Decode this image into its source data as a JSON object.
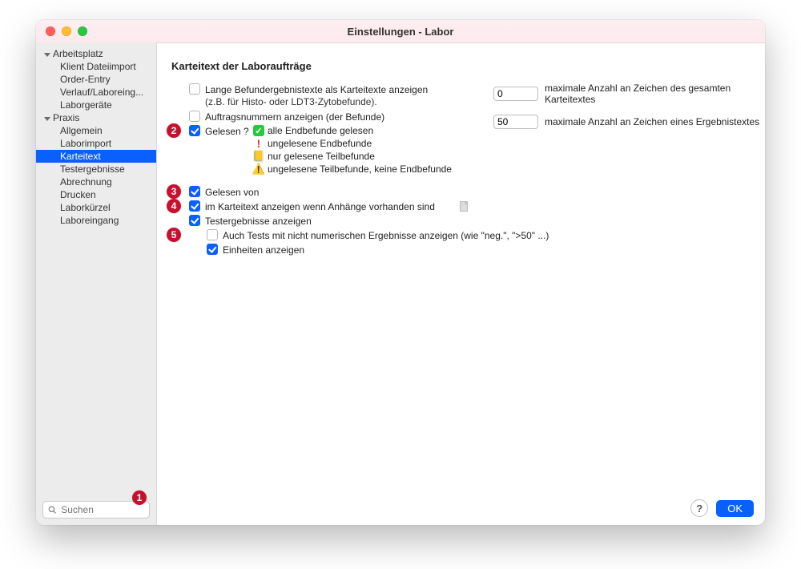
{
  "window": {
    "title": "Einstellungen - Labor"
  },
  "sidebar": {
    "search_placeholder": "Suchen",
    "groups": [
      {
        "label": "Arbeitsplatz",
        "items": [
          "Klient Dateiimport",
          "Order-Entry",
          "Verlauf/Laboreing...",
          "Laborgeräte"
        ]
      },
      {
        "label": "Praxis",
        "items": [
          "Allgemein",
          "Laborimport",
          "Karteitext",
          "Testergebnisse",
          "Abrechnung",
          "Drucken",
          "Laborkürzel",
          "Laboreingang"
        ]
      }
    ],
    "selected": "Karteitext"
  },
  "section": {
    "title": "Karteitext der Laboraufträge"
  },
  "options": {
    "long_results": {
      "checked": false,
      "label": "Lange Befundergebnistexte als Karteitexte anzeigen",
      "sublabel": "(z.B. für Histo- oder LDT3-Zytobefunde)."
    },
    "order_numbers": {
      "checked": false,
      "label": "Auftragsnummern anzeigen (der Befunde)"
    },
    "gelesen": {
      "checked": true,
      "label": "Gelesen ?",
      "legend": [
        {
          "icon": "check-green",
          "text": "alle Endbefunde gelesen"
        },
        {
          "icon": "excl-red",
          "text": "ungelesene Endbefunde"
        },
        {
          "icon": "note",
          "text": "nur gelesene Teilbefunde"
        },
        {
          "icon": "warn",
          "text": "ungelesene Teilbefunde, keine Endbefunde"
        }
      ]
    },
    "gelesen_von": {
      "checked": true,
      "label": "Gelesen von"
    },
    "anhaenge": {
      "checked": true,
      "label": "im Karteitext anzeigen wenn Anhänge vorhanden sind"
    },
    "testergebnisse": {
      "checked": true,
      "label": "Testergebnisse anzeigen"
    },
    "auch_nicht_num": {
      "checked": false,
      "label": "Auch Tests mit nicht numerischen Ergebnisse anzeigen (wie \"neg.\", \">50\" ...)"
    },
    "einheiten": {
      "checked": true,
      "label": "Einheiten anzeigen"
    }
  },
  "fields": {
    "max_total": {
      "value": "0",
      "label": "maximale Anzahl an Zeichen des gesamten Karteitextes"
    },
    "max_result": {
      "value": "50",
      "label": "maximale Anzahl an Zeichen eines Ergebnistextes"
    }
  },
  "footer": {
    "help": "?",
    "ok": "OK"
  },
  "annotations": {
    "a1": "1",
    "a2": "2",
    "a3": "3",
    "a4": "4",
    "a5": "5"
  }
}
